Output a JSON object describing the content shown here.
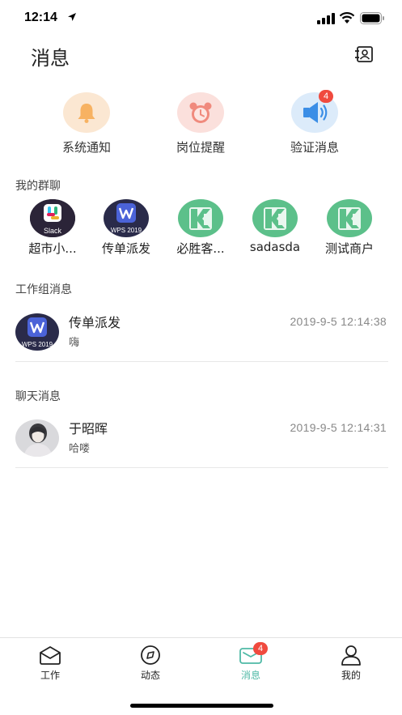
{
  "status_bar": {
    "time": "12:14"
  },
  "header": {
    "title": "消息"
  },
  "quick_entries": [
    {
      "label": "系统通知",
      "icon": "bell-icon",
      "color": "#f7b262"
    },
    {
      "label": "岗位提醒",
      "icon": "alarm-clock-icon",
      "color": "#f08a7d"
    },
    {
      "label": "验证消息",
      "icon": "speaker-icon",
      "color": "#3b8ee6",
      "badge": "4"
    }
  ],
  "groups": {
    "title": "我的群聊",
    "items": [
      {
        "label": "超市小...",
        "avatar": "slack-app-icon",
        "avatar_text": "Slack"
      },
      {
        "label": "传单派发",
        "avatar": "wps-app-icon",
        "avatar_text": "WPS 2019"
      },
      {
        "label": "必胜客...",
        "avatar": "group-logo-icon"
      },
      {
        "label": "sadasda",
        "avatar": "group-logo-icon"
      },
      {
        "label": "测试商户",
        "avatar": "group-logo-icon"
      }
    ]
  },
  "work_messages": {
    "title": "工作组消息",
    "items": [
      {
        "name": "传单派发",
        "preview": "嗨",
        "time": "2019-9-5 12:14:38",
        "avatar_text": "WPS 2019"
      }
    ]
  },
  "chat_messages": {
    "title": "聊天消息",
    "items": [
      {
        "name": "于昭晖",
        "preview": "哈喽",
        "time": "2019-9-5 12:14:31"
      }
    ]
  },
  "tabs": [
    {
      "label": "工作",
      "icon": "work-icon"
    },
    {
      "label": "动态",
      "icon": "compass-icon"
    },
    {
      "label": "消息",
      "icon": "mail-icon",
      "badge": "4",
      "active": true
    },
    {
      "label": "我的",
      "icon": "profile-icon"
    }
  ],
  "colors": {
    "accent": "#4fb9a6",
    "badge": "#f04a3e",
    "text": "#222222",
    "muted": "#888888"
  }
}
